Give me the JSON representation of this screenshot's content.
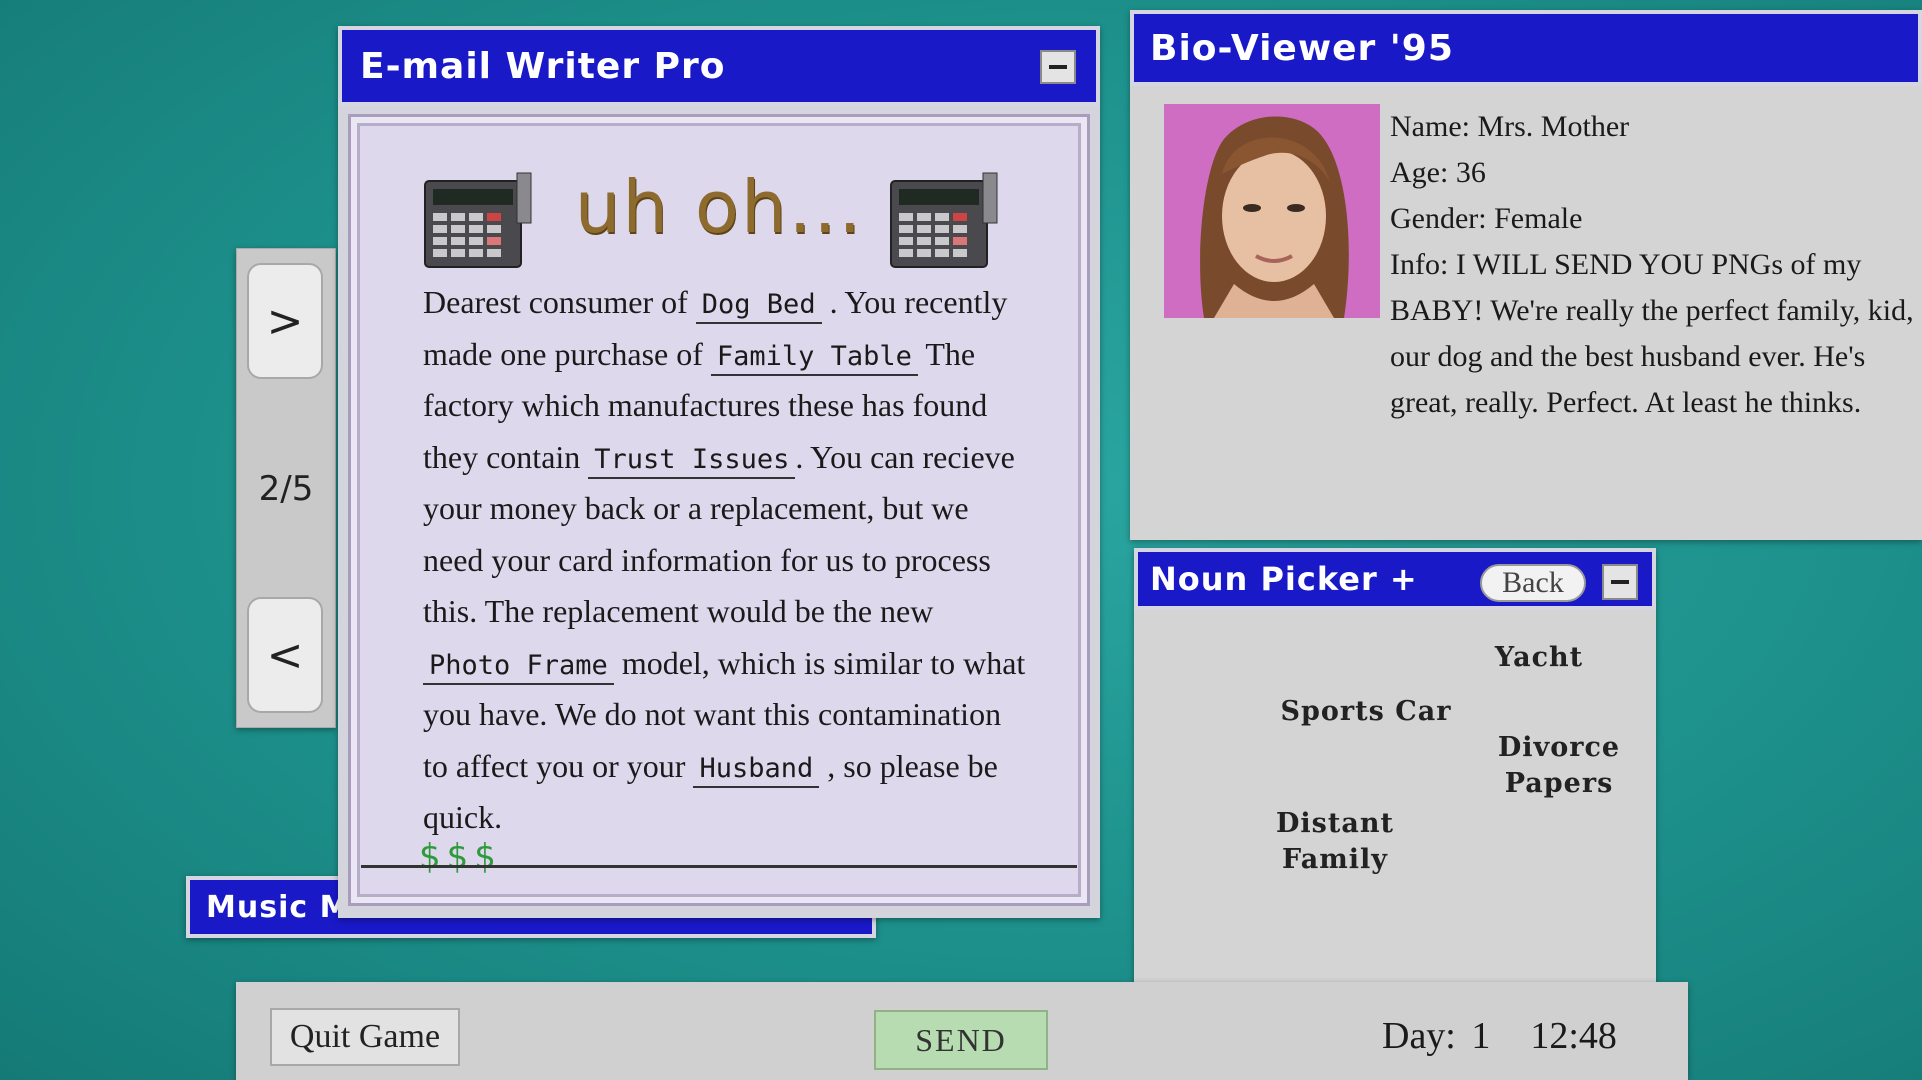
{
  "email": {
    "title": "E-mail Writer Pro",
    "headline": "uh oh...",
    "text": {
      "t1": "Dearest consumer of ",
      "t2": " . You recently made one purchase of ",
      "t3": " The factory which manufactures these has found they contain ",
      "t4": ". You can recieve your money back or a replacement, but we need your card information for us to process this. The replacement would be the new ",
      "t5": " model, which is similar to what you have. We do not want this contamination to affect you or your ",
      "t6": " , so please be quick."
    },
    "blanks": [
      "Dog Bed",
      "Family Table",
      "Trust Issues",
      "Photo Frame",
      "Husband"
    ],
    "money_symbols": "$$$"
  },
  "pager": {
    "next": ">",
    "prev": "<",
    "count": "2/5"
  },
  "bio": {
    "title": "Bio-Viewer '95",
    "name": "Name: Mrs. Mother",
    "age": "Age: 36",
    "gender": "Gender: Female",
    "info": "Info: I WILL SEND YOU PNGs of my BABY! We're really the perfect family, kid, our dog and the best husband ever. He's great, really. Perfect. At least he thinks."
  },
  "noun_picker": {
    "title": "Noun Picker +",
    "back": "Back",
    "words": [
      "Yacht",
      "Sports Car",
      "Divorce Papers",
      "Distant Family"
    ]
  },
  "music": {
    "title": "Music M"
  },
  "bottom": {
    "quit": "Quit Game",
    "send": "SEND",
    "day": "Day: 1",
    "time": "12:48"
  },
  "colors": {
    "titlebar": "#1919c8",
    "background": "#1d908b",
    "photo_bg": "#cf6dc2",
    "send": "#b8dcb1"
  }
}
